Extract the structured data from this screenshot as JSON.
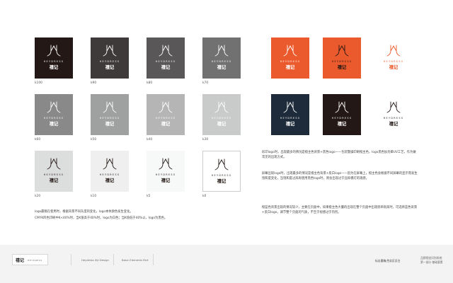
{
  "brand": {
    "name_en": "HEYDRESS",
    "name_cn": "禧记"
  },
  "swatches_left": [
    {
      "label": "k100",
      "bg": "#231815",
      "fg": "#ffffff"
    },
    {
      "label": "k90",
      "bg": "#3e3a39",
      "fg": "#ffffff"
    },
    {
      "label": "k80",
      "bg": "#595757",
      "fg": "#ffffff"
    },
    {
      "label": "k70",
      "bg": "#727171",
      "fg": "#ffffff"
    },
    {
      "label": "k60",
      "bg": "#898989",
      "fg": "#ffffff"
    },
    {
      "label": "k50",
      "bg": "#9fa0a0",
      "fg": "#ffffff"
    },
    {
      "label": "k40",
      "bg": "#b5b5b6",
      "fg": "#ffffff"
    },
    {
      "label": "k30",
      "bg": "#c9caca",
      "fg": "#ffffff"
    },
    {
      "label": "k20",
      "bg": "#dcdddd",
      "fg": "#231815"
    },
    {
      "label": "k10",
      "bg": "#efefef",
      "fg": "#231815"
    },
    {
      "label": "k5",
      "bg": "#f7f8f8",
      "fg": "#231815"
    },
    {
      "label": "k0",
      "bg": "#ffffff",
      "fg": "#231815",
      "border": "#cccccc"
    }
  ],
  "swatches_right": [
    {
      "bg": "#eb5a2c",
      "fg": "#ffffff"
    },
    {
      "bg": "#eb5a2c",
      "fg": "#231815"
    },
    {
      "bg": "#ffffff",
      "fg": "#eb5a2c"
    },
    {
      "bg": "#1e2b3a",
      "fg": "#ffffff"
    },
    {
      "bg": "#231815",
      "fg": "#ffffff"
    },
    {
      "bg": "#ffffff",
      "fg": "#231815"
    }
  ],
  "text": {
    "left_note_1": "logo最稿在使用时，根据背景不同灰度的变化，logo本体颜色发生变化。",
    "left_note_2": "CMYK四色印刷中K<40%时，当K值高于40%时，logo为白色；当K值低于40%以，logo为黑色。",
    "right_para_1": "彩印logo时，出现最多的情况是橙主色背景+黑色logo——包装暨操印刷橙主色，logo黑色加亮晕UV工艺，作为做常见的出现方式。",
    "right_para_2": "屏幕出现logo时，出现最多的情况是橙主色背景+反白logo——因为在屏幕上，橙主色会根据不同屏幕的显示而发生饱和度变化，当饱和度过高再使用黑色logo时，则会出现过于压抑模灯的观感。",
    "right_para_3": "橙蓝色背景出现的情况较少，主要在页面中，如果橙主色大量的出现在整个页面中出现频率很高时，可选择蓝色背景+反白logo，调节整个页面的气质，不至于视感过于热烈。"
  },
  "footer": {
    "logo_cn": "禧记",
    "logo_en": "HEYDRESS",
    "item_1": "Heydress Xiji Design",
    "item_2": "Basic Elements Part",
    "right_label": "标志墨稿|色彩反反白",
    "right_note_1": "品牌视觉识别系统",
    "right_note_2": "第一部分 基础要素"
  }
}
